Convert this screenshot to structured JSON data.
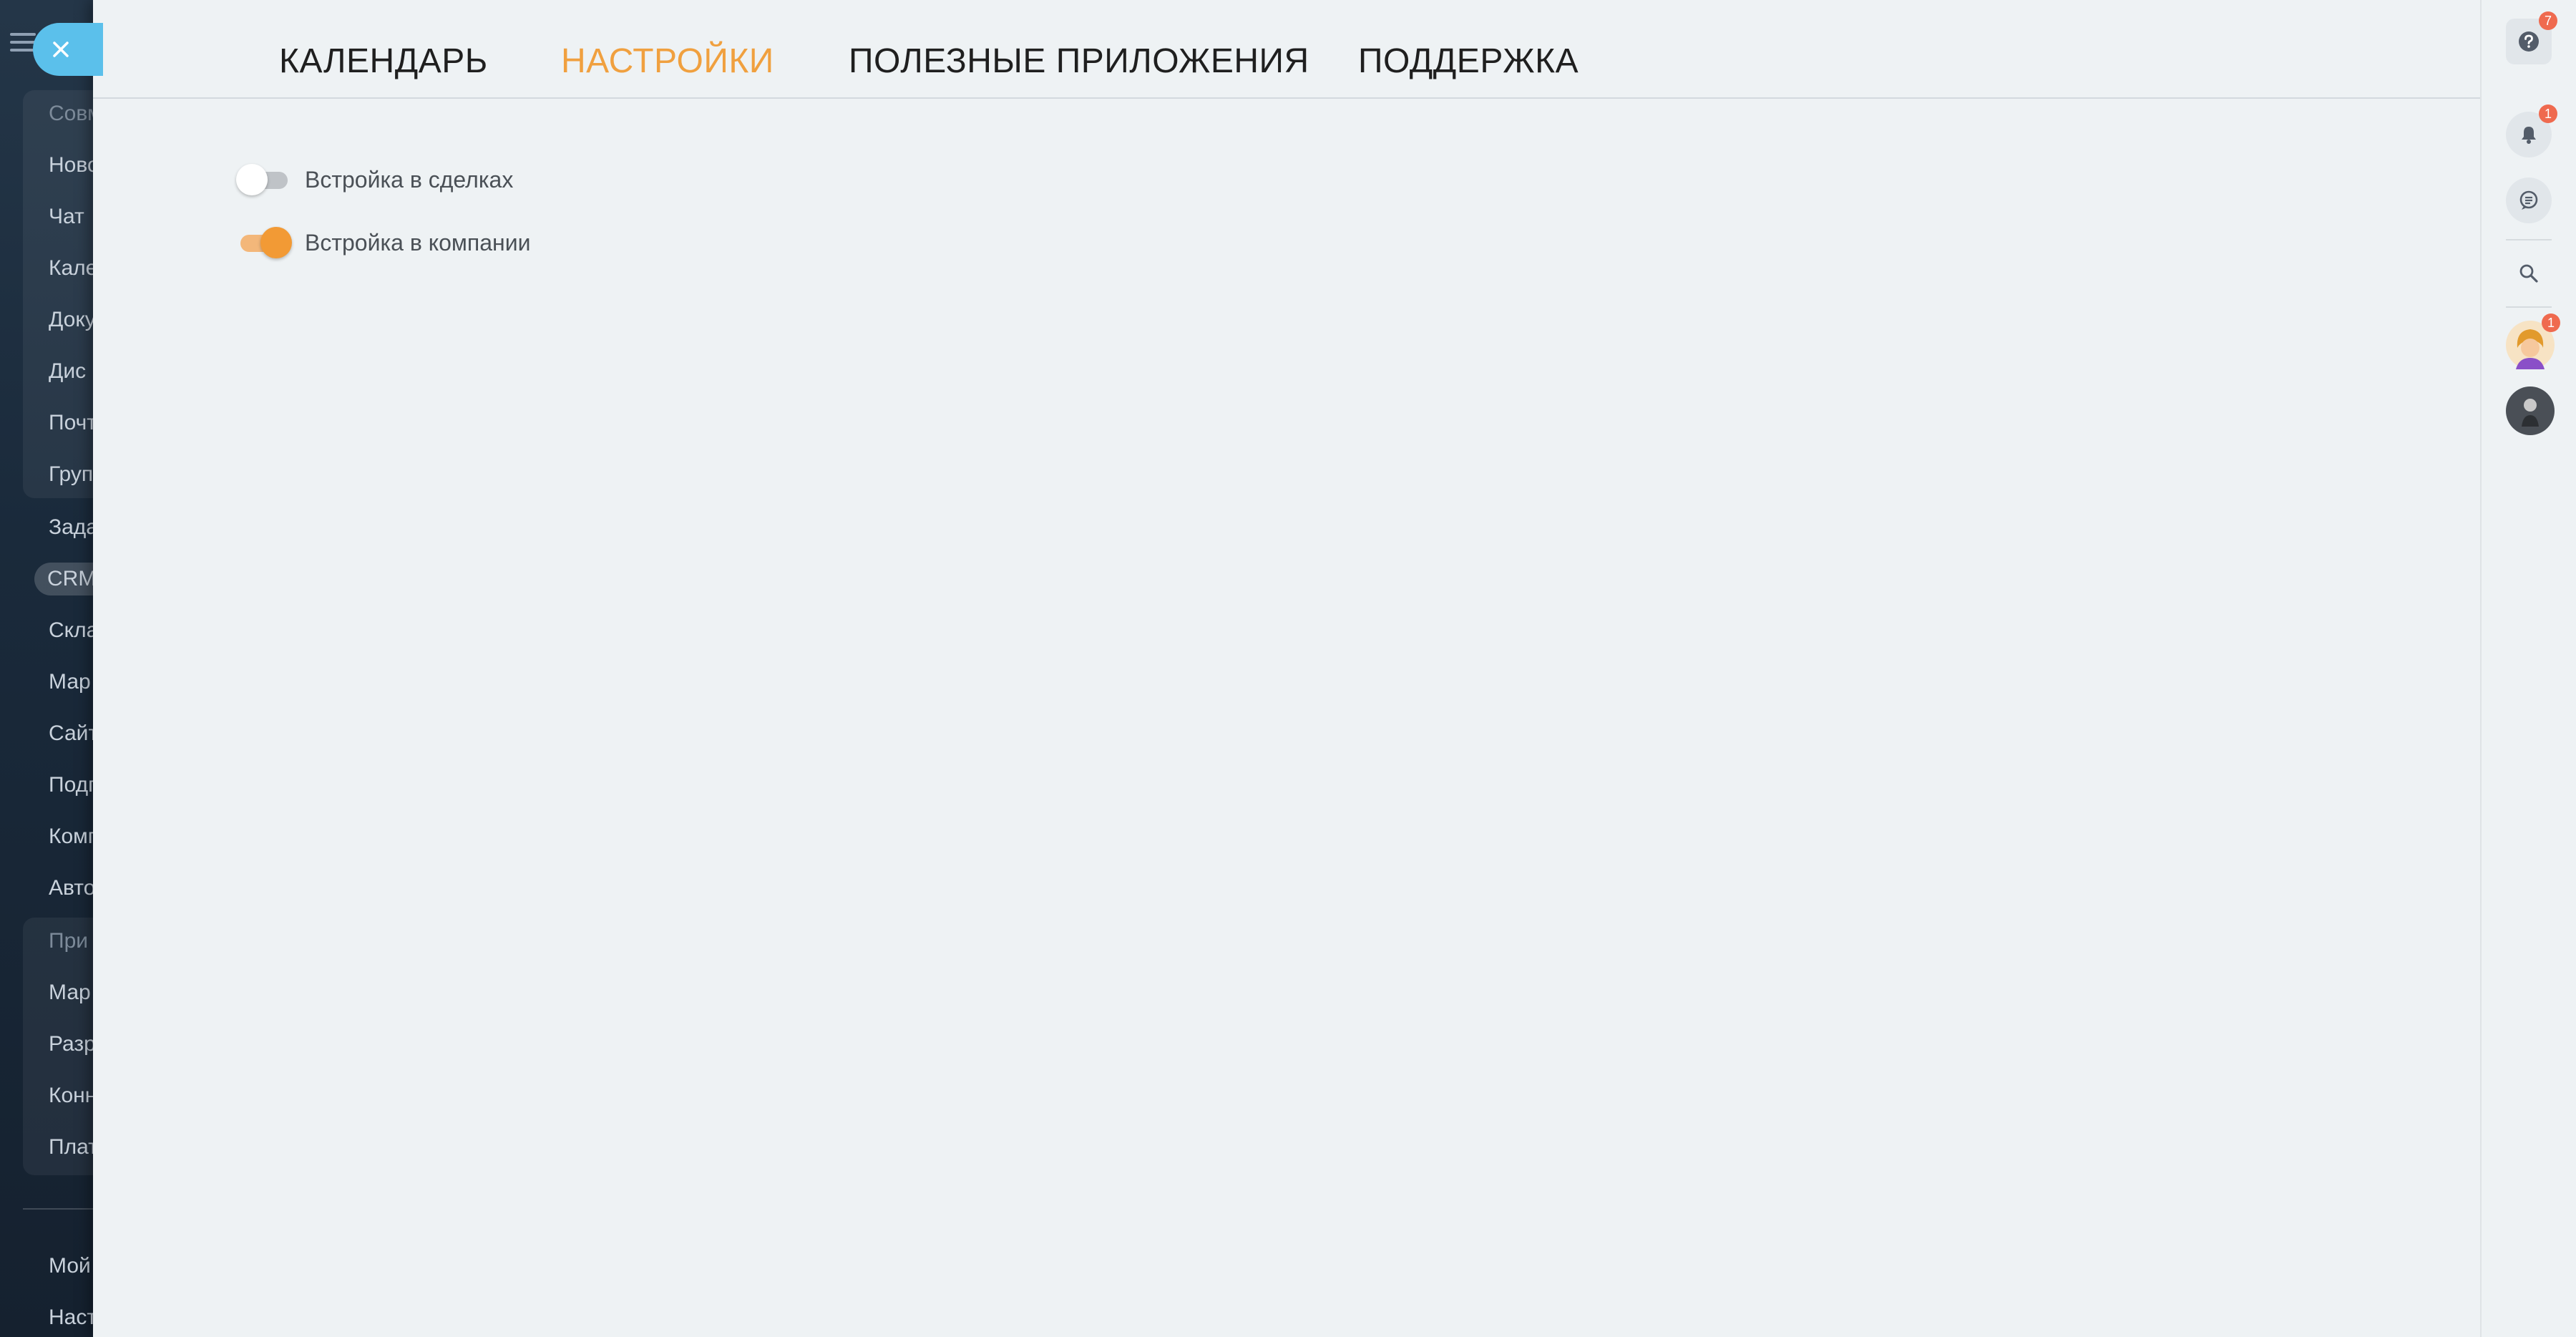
{
  "sidebar": {
    "items": [
      {
        "label": "Совм",
        "dim": true
      },
      {
        "label": "Ново",
        "dim": false
      },
      {
        "label": "Чат ",
        "dim": false
      },
      {
        "label": "Кале",
        "dim": false
      },
      {
        "label": "Доку",
        "dim": false
      },
      {
        "label": "Дис",
        "dim": false
      },
      {
        "label": "Почт",
        "dim": false
      },
      {
        "label": "Груп",
        "dim": false
      },
      {
        "label": "Зада",
        "dim": false
      },
      {
        "label": "CRM",
        "dim": false
      },
      {
        "label": "Скла",
        "dim": false
      },
      {
        "label": "Мар",
        "dim": false
      },
      {
        "label": "Сайт",
        "dim": false
      },
      {
        "label": "Подп",
        "dim": false
      },
      {
        "label": "Комп",
        "dim": false
      },
      {
        "label": "Авто",
        "dim": false
      },
      {
        "label": "При",
        "dim": true
      },
      {
        "label": "Мар",
        "dim": false
      },
      {
        "label": "Разр",
        "dim": false
      },
      {
        "label": "Конн",
        "dim": false
      },
      {
        "label": "Плат",
        "dim": false
      },
      {
        "label": "Мой",
        "dim": false
      },
      {
        "label": "Наст",
        "dim": false
      }
    ]
  },
  "tabs": [
    {
      "label": "КАЛЕНДАРЬ",
      "active": false
    },
    {
      "label": "НАСТРОЙКИ",
      "active": true
    },
    {
      "label": "ПОЛЕЗНЫЕ ПРИЛОЖЕНИЯ",
      "active": false
    },
    {
      "label": "ПОДДЕРЖКА",
      "active": false
    }
  ],
  "settings": {
    "toggles": [
      {
        "label": "Встройка в сделках",
        "enabled": false
      },
      {
        "label": "Встройка в компании",
        "enabled": true
      }
    ]
  },
  "rightbar": {
    "help_badge": "7",
    "notifications_badge": "1",
    "user_badge": "1",
    "icons": [
      "help-icon",
      "bell-icon",
      "chat-icon",
      "search-icon"
    ]
  },
  "colors": {
    "accent": "#f0a03f",
    "close_button": "#5bc0eb",
    "badge": "#ef6a4f",
    "panel_background": "#eef2f4"
  }
}
